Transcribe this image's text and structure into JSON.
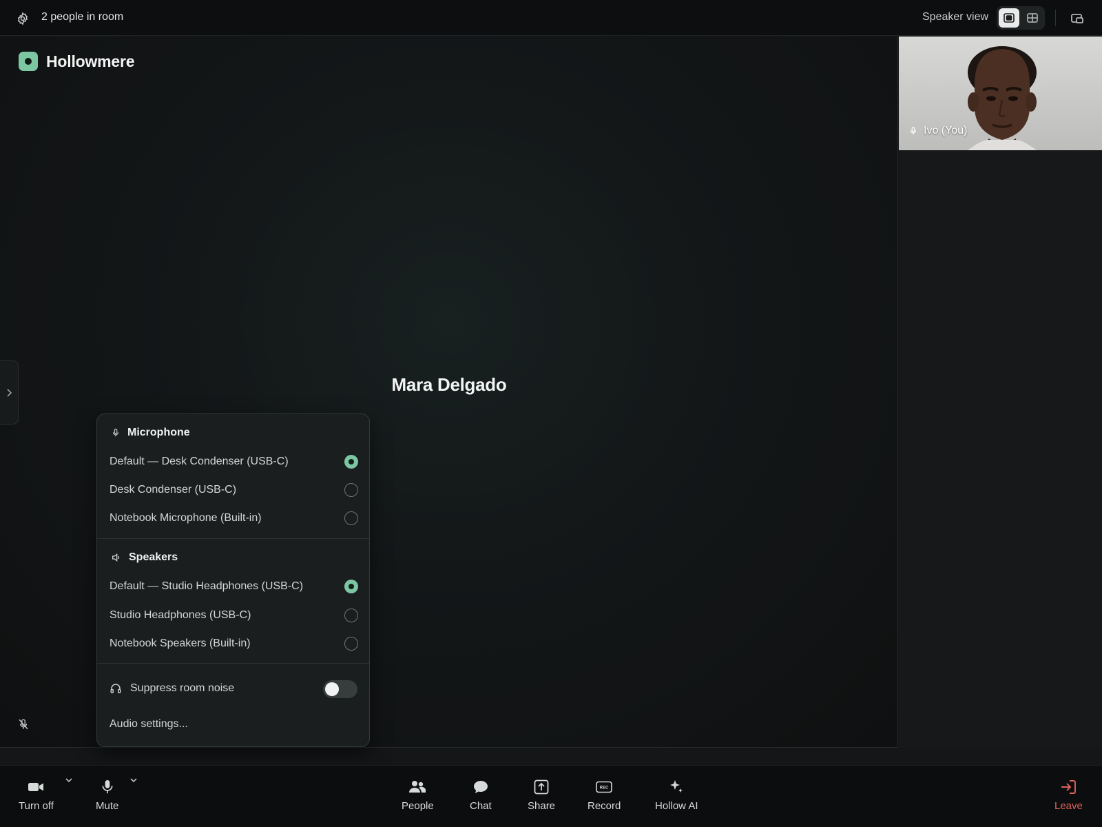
{
  "topbar": {
    "room_count": "2 people in room",
    "view_label": "Speaker view",
    "views": [
      "speaker",
      "grid"
    ],
    "active_view": "speaker"
  },
  "brand": {
    "name": "Hollowmere",
    "color": "#7cc7a2"
  },
  "stage": {
    "active_speaker": "Mara Delgado"
  },
  "self_tile": {
    "name": "Ivo (You)"
  },
  "audio_menu": {
    "microphone": {
      "title": "Microphone",
      "options": [
        {
          "label": "Default — Desk Condenser (USB-C)",
          "selected": true
        },
        {
          "label": "Desk Condenser (USB-C)",
          "selected": false
        },
        {
          "label": "Notebook Microphone (Built-in)",
          "selected": false
        }
      ]
    },
    "speakers": {
      "title": "Speakers",
      "options": [
        {
          "label": "Default — Studio Headphones (USB-C)",
          "selected": true
        },
        {
          "label": "Studio Headphones (USB-C)",
          "selected": false
        },
        {
          "label": "Notebook Speakers (Built-in)",
          "selected": false
        }
      ]
    },
    "noise_suppression": {
      "label": "Suppress room noise",
      "enabled": false
    },
    "settings_link": "Audio settings..."
  },
  "toolbar": {
    "camera": "Turn off",
    "mute": "Mute",
    "people": "People",
    "chat": "Chat",
    "share": "Share",
    "record": "Record",
    "ai": "Hollow AI",
    "leave": "Leave"
  },
  "colors": {
    "accent": "#7cc7a2",
    "danger": "#e0625c",
    "background": "#141617"
  }
}
